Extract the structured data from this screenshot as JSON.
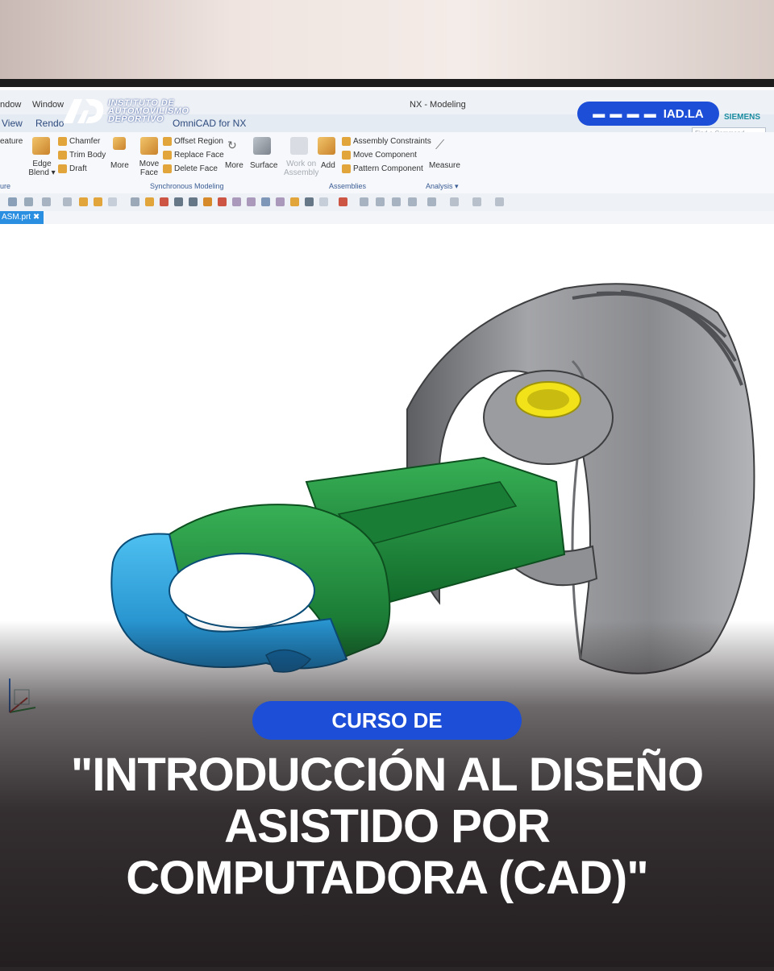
{
  "app": {
    "window_title": "NX - Modeling",
    "vendor": "SIEMENS",
    "menus": [
      "ndow",
      "Window",
      "View",
      "Rendo",
      "OmniCAD for NX"
    ],
    "search_placeholder": "Find a Command",
    "doc_tab": "ASM.prt ✖"
  },
  "ribbon": {
    "feature": "eature",
    "edge_blend": "Edge Blend ▾",
    "chamfer": "Chamfer",
    "trim_body": "Trim Body",
    "draft": "Draft",
    "more_1": "More",
    "move_face": "Move Face",
    "offset_region": "Offset Region",
    "replace_face": "Replace Face",
    "delete_face": "Delete Face",
    "more_2": "More",
    "surface": "Surface",
    "work_on_assembly": "Work on Assembly",
    "add": "Add",
    "assembly_constraints": "Assembly Constraints",
    "move_component": "Move Component",
    "pattern_component": "Pattern Component",
    "measure": "Measure",
    "group_feature": "ure",
    "group_sync": "Synchronous Modeling",
    "group_assemblies": "Assemblies",
    "group_analysis": "Analysis ▾"
  },
  "brand": {
    "logo_letters": "AD",
    "logo_line1": "INSTITUTO DE",
    "logo_line2": "AUTOMOVILISMO",
    "logo_line3": "DEPORTIVO",
    "site": "IAD.LA",
    "accent": "#1d4ed8"
  },
  "course": {
    "kicker": "CURSO DE",
    "title_line1": "\"INTRODUCCIÓN AL DISEÑO",
    "title_line2": "ASISTIDO POR",
    "title_line3": "COMPUTADORA (CAD)\""
  },
  "model": {
    "name": "piston-and-connecting-rod",
    "colors": {
      "piston": "#8e8f92",
      "rod": "#1f8a3c",
      "rod_cap": "#2a9fd8",
      "pin_bushing": "#f1e21a"
    }
  }
}
